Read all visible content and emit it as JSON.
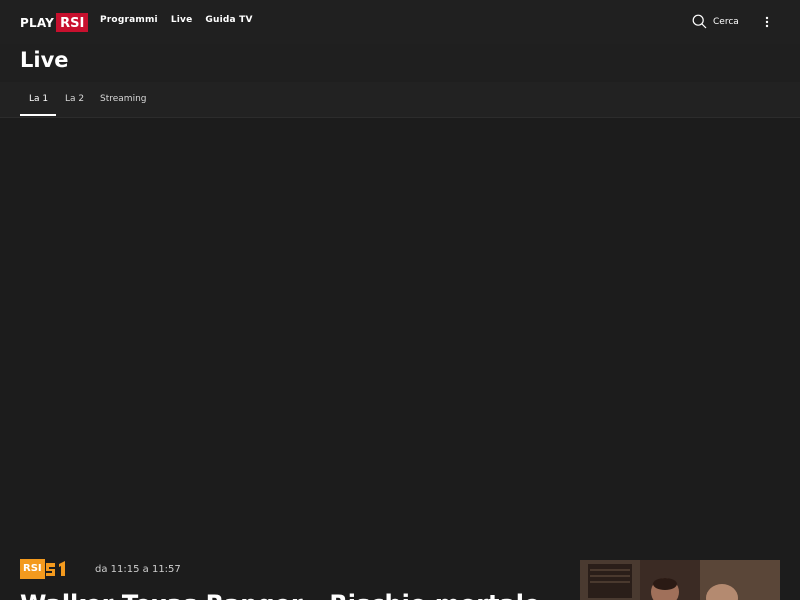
{
  "header": {
    "logo_play": "PLAY",
    "logo_rsi": "RSI",
    "nav": [
      "Programmi",
      "Live",
      "Guida TV"
    ],
    "search_label": "Cerca"
  },
  "page": {
    "title": "Live"
  },
  "tabs": [
    {
      "label": "La 1",
      "active": true
    },
    {
      "label": "La 2",
      "active": false
    },
    {
      "label": "Streaming",
      "active": false
    }
  ],
  "program": {
    "channel_logo_text": "RSI",
    "time": "da 11:15 a 11:57",
    "title": "Walker Texas Ranger - Rischio mortale"
  },
  "colors": {
    "background": "#1c1c1c",
    "brand_red": "#c8102e",
    "channel_orange": "#f39a1e"
  }
}
